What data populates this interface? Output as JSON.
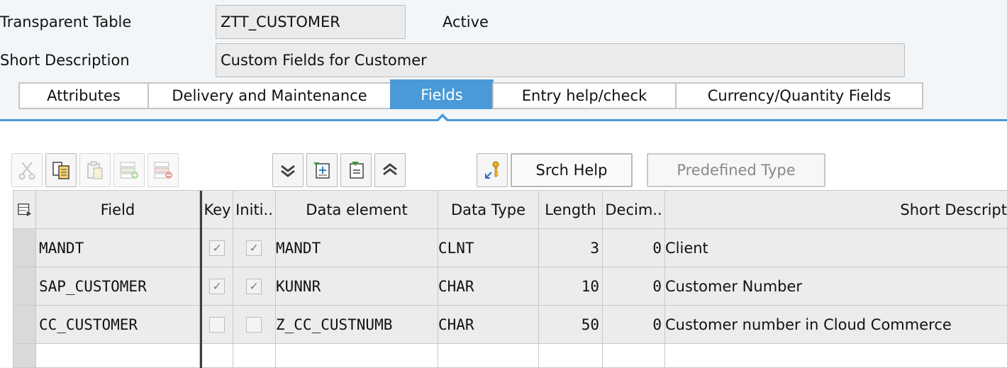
{
  "header": {
    "table_label": "Transparent Table",
    "table_name": "ZTT_CUSTOMER",
    "status": "Active",
    "short_desc_label": "Short Description",
    "short_desc_value": "Custom Fields for Customer"
  },
  "tabs": [
    {
      "label": "Attributes",
      "active": false
    },
    {
      "label": "Delivery and Maintenance",
      "active": false
    },
    {
      "label": "Fields",
      "active": true
    },
    {
      "label": "Entry help/check",
      "active": false
    },
    {
      "label": "Currency/Quantity Fields",
      "active": false
    }
  ],
  "toolbar": {
    "icons": [
      "cut-icon",
      "copy-icon",
      "paste-icon",
      "insert-row-icon",
      "delete-row-icon",
      "collapse-all-icon",
      "import-icon",
      "export-icon",
      "expand-all-icon",
      "key-icon"
    ],
    "srch_help_label": "Srch Help",
    "predefined_type_label": "Predefined Type"
  },
  "table": {
    "columns": [
      "Field",
      "Key",
      "Initi..",
      "Data element",
      "Data Type",
      "Length",
      "Decim..",
      "Short Descript"
    ],
    "rows": [
      {
        "field": "MANDT",
        "key": true,
        "initial": true,
        "data_element": "MANDT",
        "data_type": "CLNT",
        "length": "3",
        "decimals": "0",
        "short_desc": "Client"
      },
      {
        "field": "SAP_CUSTOMER",
        "key": true,
        "initial": true,
        "data_element": "KUNNR",
        "data_type": "CHAR",
        "length": "10",
        "decimals": "0",
        "short_desc": "Customer Number"
      },
      {
        "field": "CC_CUSTOMER",
        "key": false,
        "initial": false,
        "data_element": "Z_CC_CUSTNUMB",
        "data_type": "CHAR",
        "length": "50",
        "decimals": "0",
        "short_desc": "Customer number in Cloud Commerce"
      }
    ]
  },
  "colors": {
    "accent": "#4a9ad8",
    "header_bg": "#ececec",
    "cell_bg": "#ececec"
  }
}
